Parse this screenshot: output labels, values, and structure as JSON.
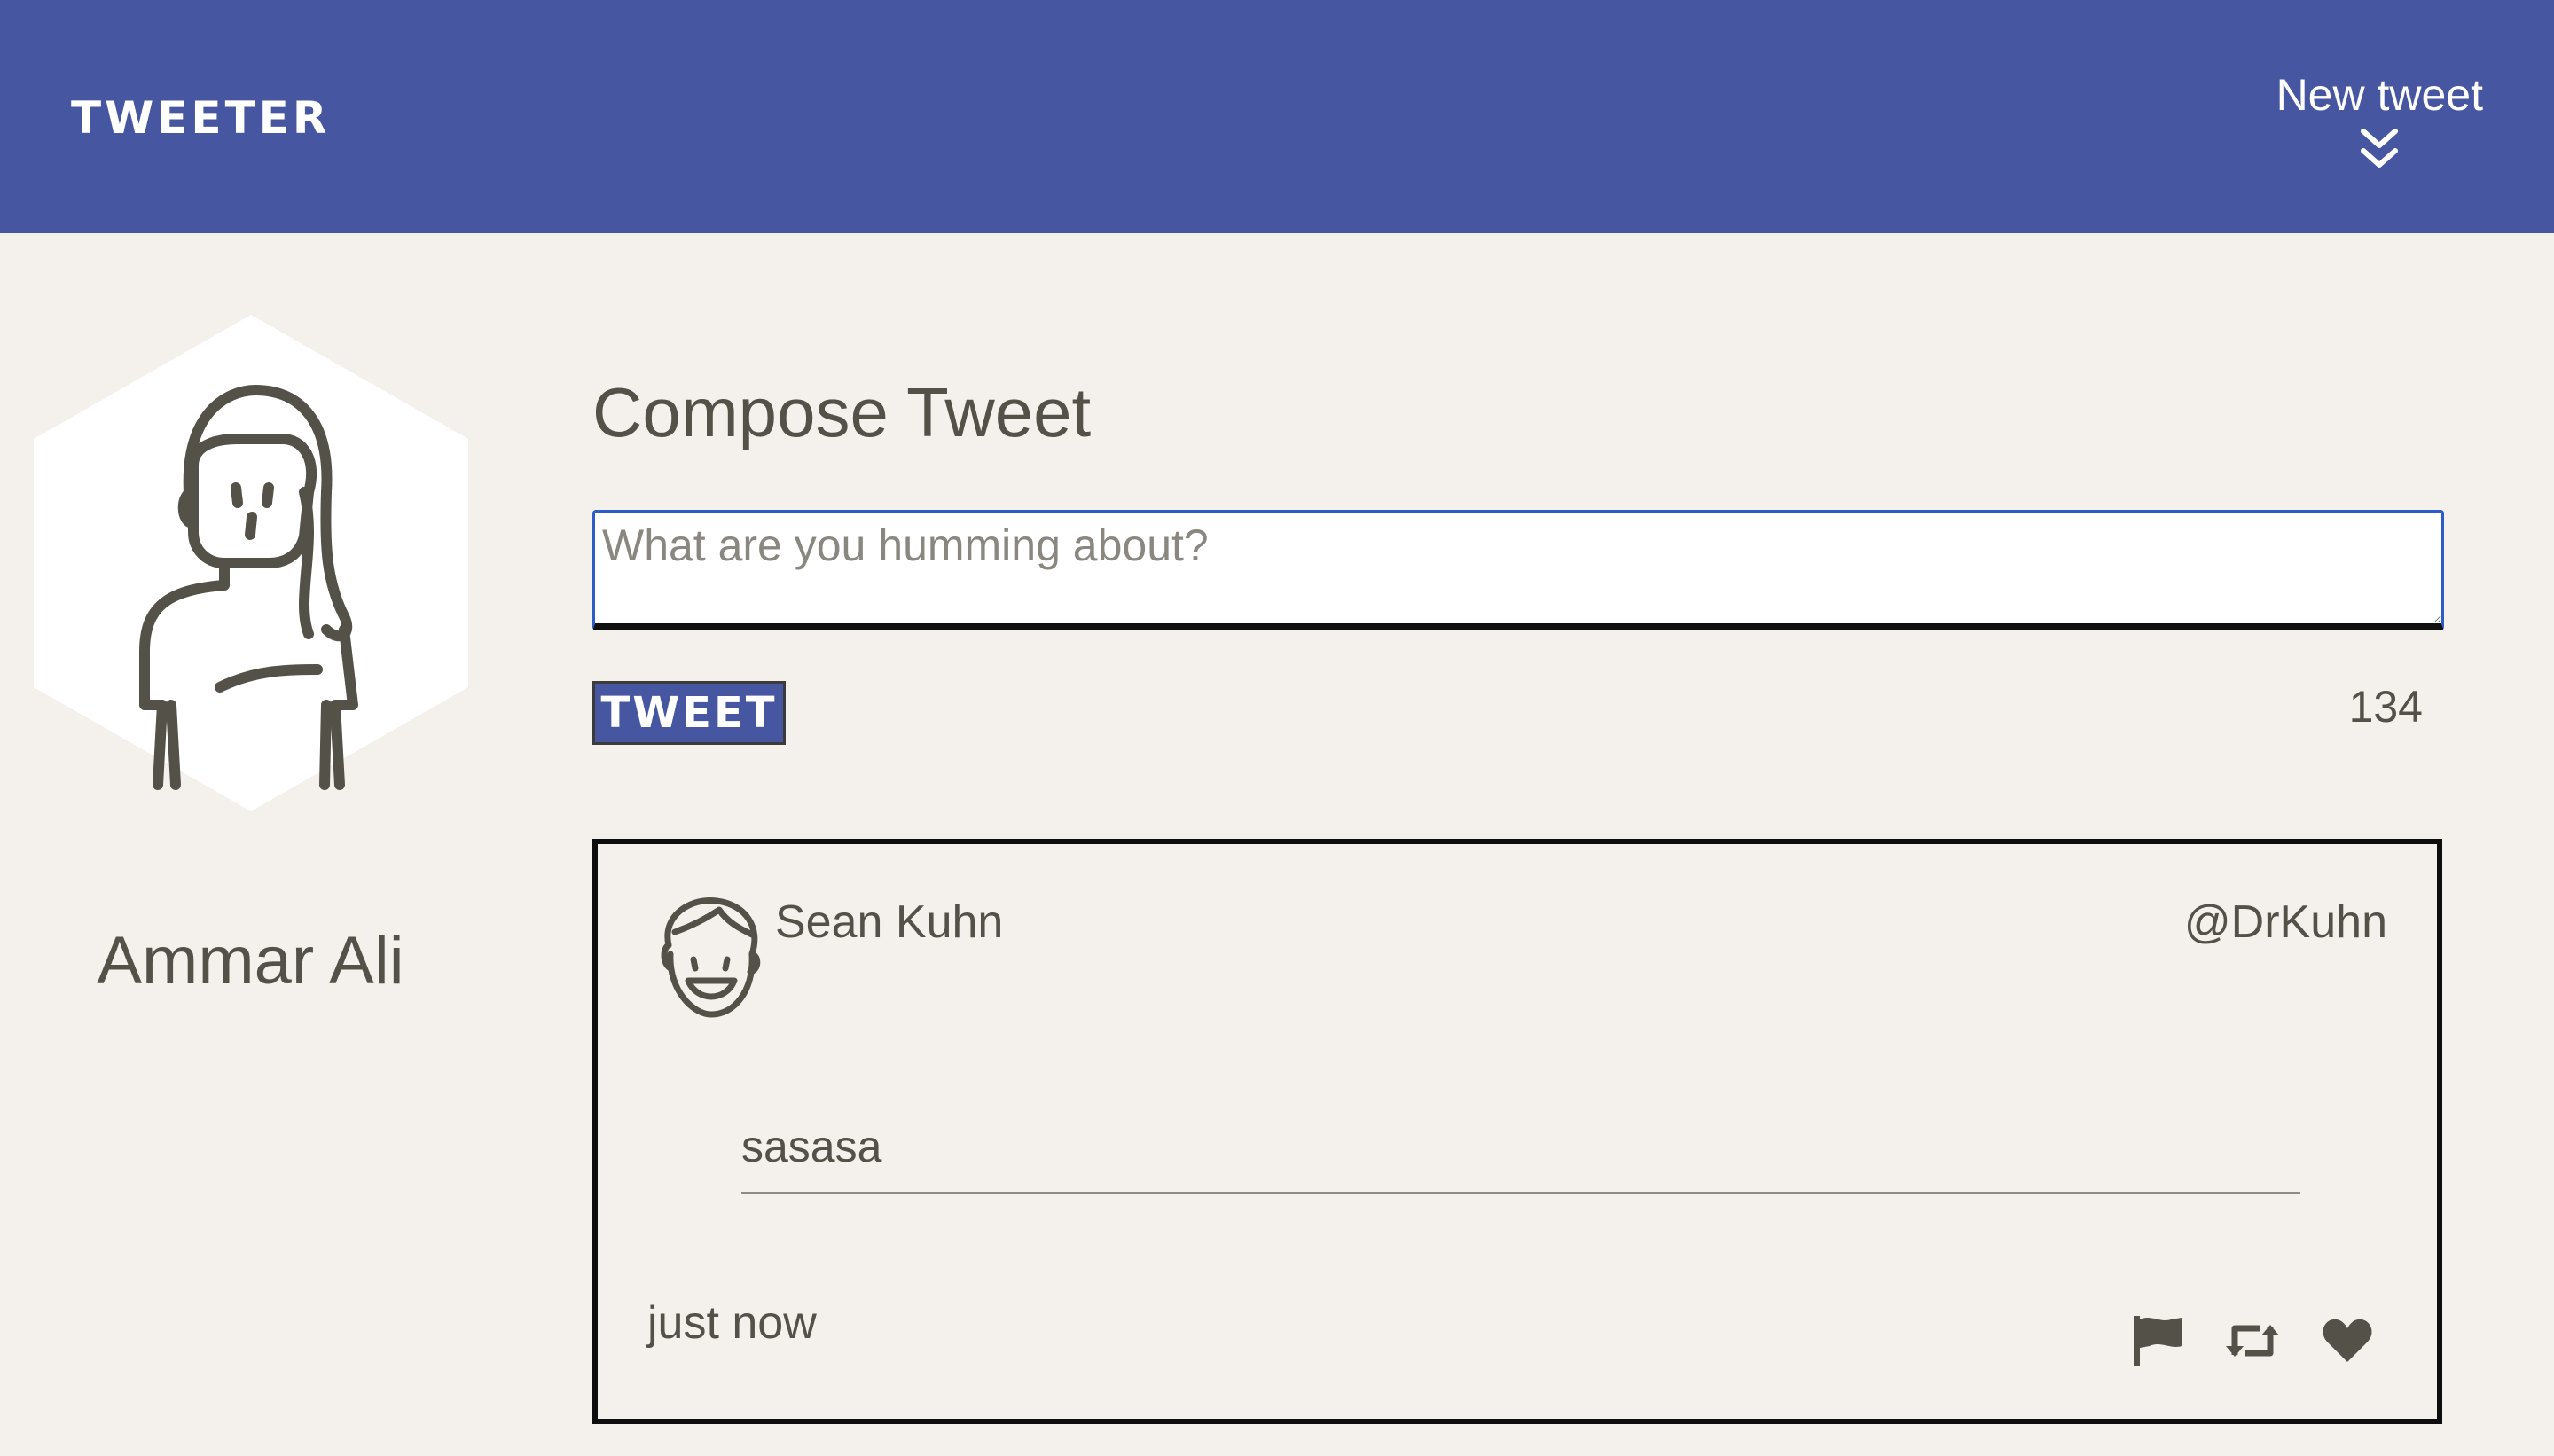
{
  "header": {
    "brand": "TWEETER",
    "new_tweet_label": "New tweet",
    "new_tweet_icon": "double-chevron-down-icon",
    "background_color": "#4656a0"
  },
  "profile": {
    "name": "Ammar Ali",
    "avatar_icon": "female-avatar-icon"
  },
  "compose": {
    "title": "Compose Tweet",
    "placeholder": "What are you humming about?",
    "value": "",
    "button_label": "TWEET",
    "char_count": "134"
  },
  "tweets": [
    {
      "author": "Sean Kuhn",
      "handle": "@DrKuhn",
      "avatar_icon": "smiling-man-avatar-icon",
      "body": "sasasa",
      "time": "just now",
      "actions": [
        "flag-icon",
        "retweet-icon",
        "heart-icon"
      ]
    }
  ],
  "colors": {
    "page_background": "#f4f1ec",
    "text": "#545149",
    "accent": "#4656a0",
    "input_focus": "#2b5cc7"
  }
}
